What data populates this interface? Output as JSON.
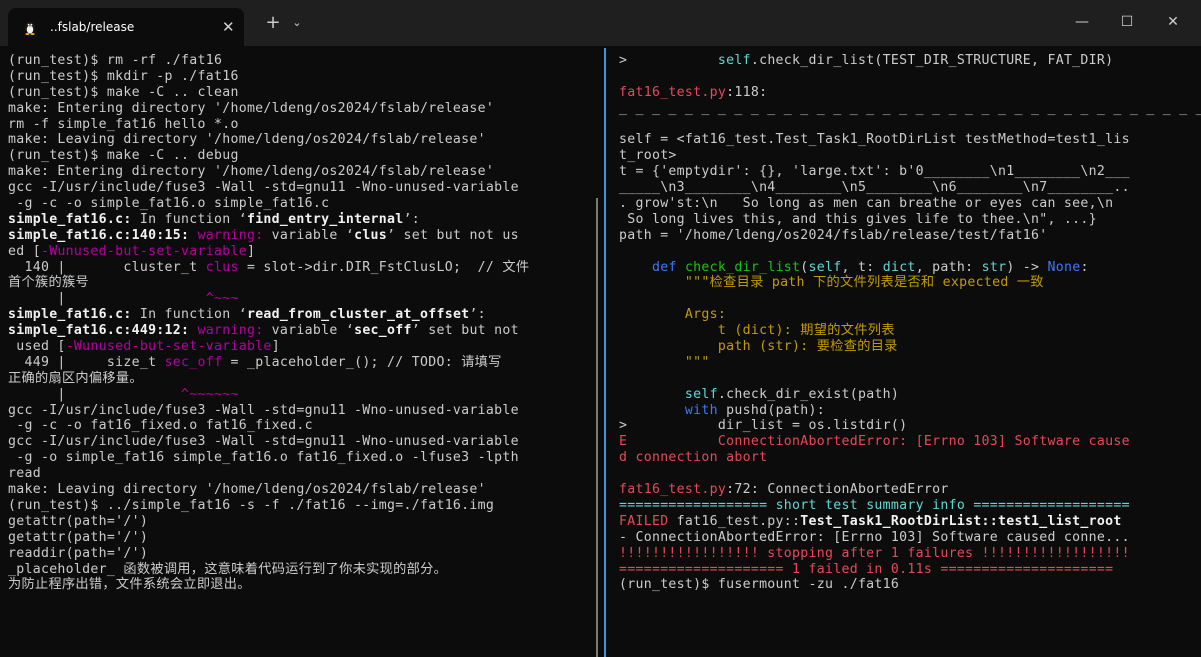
{
  "window": {
    "tab_title": "..fslab/release",
    "tab_icon": "tux-penguin-icon",
    "close_tab_glyph": "✕",
    "new_tab_glyph": "+",
    "dropdown_glyph": "⌄",
    "minimize_glyph": "—",
    "maximize_glyph": "☐",
    "close_glyph": "✕"
  },
  "colors": {
    "terminal_bg": "#0c0c0c",
    "titlebar_bg": "#1f1f1f",
    "pane_divider": "#3a96dd",
    "text": "#cccccc",
    "magenta": "#b4009e",
    "red": "#e74856",
    "yellow": "#c19c00",
    "blue": "#3b78ff",
    "green": "#16c60c",
    "cyan": "#61d6d6"
  },
  "left_pane": {
    "lines": [
      [
        {
          "t": "(run_test)$ rm -rf ./fat16"
        }
      ],
      [
        {
          "t": "(run_test)$ mkdir -p ./fat16"
        }
      ],
      [
        {
          "t": "(run_test)$ make -C .. clean"
        }
      ],
      [
        {
          "t": "make: Entering directory '/home/ldeng/os2024/fslab/release'"
        }
      ],
      [
        {
          "t": "rm -f simple_fat16 hello *.o"
        }
      ],
      [
        {
          "t": "make: Leaving directory '/home/ldeng/os2024/fslab/release'"
        }
      ],
      [
        {
          "t": "(run_test)$ make -C .. debug"
        }
      ],
      [
        {
          "t": "make: Entering directory '/home/ldeng/os2024/fslab/release'"
        }
      ],
      [
        {
          "t": "gcc -I/usr/include/fuse3 -Wall -std=gnu11 -Wno-unused-variable"
        }
      ],
      [
        {
          "t": " -g -c -o simple_fat16.o simple_fat16.c"
        }
      ],
      [
        {
          "t": "simple_fat16.c:",
          "s": "bold"
        },
        {
          "t": " In function ‘"
        },
        {
          "t": "find_entry_internal",
          "s": "bold"
        },
        {
          "t": "’:"
        }
      ],
      [
        {
          "t": "simple_fat16.c:140:15:",
          "s": "bold"
        },
        {
          "t": " warning:",
          "s": "mag"
        },
        {
          "t": " variable ‘"
        },
        {
          "t": "clus",
          "s": "bold"
        },
        {
          "t": "’ set but not us"
        }
      ],
      [
        {
          "t": "ed ["
        },
        {
          "t": "-Wunused-but-set-variable",
          "s": "mag"
        },
        {
          "t": "]"
        }
      ],
      [
        {
          "t": "  140 |       cluster_t "
        },
        {
          "t": "clus",
          "s": "mag"
        },
        {
          "t": " = slot->dir.DIR_FstClusLO;  // 文件"
        }
      ],
      [
        {
          "t": "首个簇的簇号"
        }
      ],
      [
        {
          "t": "      |                 "
        },
        {
          "t": "^~~~",
          "s": "mag"
        }
      ],
      [
        {
          "t": "simple_fat16.c:",
          "s": "bold"
        },
        {
          "t": " In function ‘"
        },
        {
          "t": "read_from_cluster_at_offset",
          "s": "bold"
        },
        {
          "t": "’:"
        }
      ],
      [
        {
          "t": "simple_fat16.c:449:12:",
          "s": "bold"
        },
        {
          "t": " warning:",
          "s": "mag"
        },
        {
          "t": " variable ‘"
        },
        {
          "t": "sec_off",
          "s": "bold"
        },
        {
          "t": "’ set but not"
        }
      ],
      [
        {
          "t": " used ["
        },
        {
          "t": "-Wunused-but-set-variable",
          "s": "mag"
        },
        {
          "t": "]"
        }
      ],
      [
        {
          "t": "  449 |     size_t "
        },
        {
          "t": "sec_off",
          "s": "mag"
        },
        {
          "t": " = _placeholder_(); // TODO: 请填写"
        }
      ],
      [
        {
          "t": "正确的扇区内偏移量。"
        }
      ],
      [
        {
          "t": "      |              "
        },
        {
          "t": "^~~~~~~",
          "s": "mag"
        }
      ],
      [
        {
          "t": "gcc -I/usr/include/fuse3 -Wall -std=gnu11 -Wno-unused-variable"
        }
      ],
      [
        {
          "t": " -g -c -o fat16_fixed.o fat16_fixed.c"
        }
      ],
      [
        {
          "t": "gcc -I/usr/include/fuse3 -Wall -std=gnu11 -Wno-unused-variable"
        }
      ],
      [
        {
          "t": " -g -o simple_fat16 simple_fat16.o fat16_fixed.o -lfuse3 -lpth"
        }
      ],
      [
        {
          "t": "read"
        }
      ],
      [
        {
          "t": "make: Leaving directory '/home/ldeng/os2024/fslab/release'"
        }
      ],
      [
        {
          "t": "(run_test)$ ../simple_fat16 -s -f ./fat16 --img=./fat16.img"
        }
      ],
      [
        {
          "t": "getattr(path='/')"
        }
      ],
      [
        {
          "t": "getattr(path='/')"
        }
      ],
      [
        {
          "t": "readdir(path='/')"
        }
      ],
      [
        {
          "t": "_placeholder_ 函数被调用，这意味着代码运行到了你未实现的部分。"
        }
      ],
      [
        {
          "t": "为防止程序出错，文件系统会立即退出。"
        }
      ]
    ]
  },
  "right_pane": {
    "lines": [
      [
        {
          "t": ">           "
        },
        {
          "t": "self",
          "s": "cyan"
        },
        {
          "t": ".check_dir_list(TEST_DIR_STRUCTURE, FAT_DIR)"
        }
      ],
      [
        {
          "t": ""
        }
      ],
      [
        {
          "t": "fat16_test.py",
          "s": "red"
        },
        {
          "t": ":118:"
        }
      ],
      [
        {
          "t": "_ _ _ _ _ _ _ _ _ _ _ _ _ _ _ _ _ _ _ _ _ _ _ _ _ _ _ _ _ _ _ _ _ _ _ _ _ _ _ _"
        }
      ],
      [
        {
          "t": ""
        }
      ],
      [
        {
          "t": "self = <fat16_test.Test_Task1_RootDirList testMethod=test1_lis"
        }
      ],
      [
        {
          "t": "t_root>"
        }
      ],
      [
        {
          "t": "t = {'emptydir': {}, 'large.txt': b'0________\\n1________\\n2___"
        }
      ],
      [
        {
          "t": "_____\\n3________\\n4________\\n5________\\n6________\\n7________.."
        }
      ],
      [
        {
          "t": ". grow'st:\\n   So long as men can breathe or eyes can see,\\n"
        }
      ],
      [
        {
          "t": " So long lives this, and this gives life to thee.\\n\", ...}"
        }
      ],
      [
        {
          "t": "path = '/home/ldeng/os2024/fslab/release/test/fat16'"
        }
      ],
      [
        {
          "t": ""
        }
      ],
      [
        {
          "t": "    "
        },
        {
          "t": "def",
          "s": "blue"
        },
        {
          "t": " "
        },
        {
          "t": "check_dir_list",
          "s": "green"
        },
        {
          "t": "("
        },
        {
          "t": "self",
          "s": "cyan"
        },
        {
          "t": ", t: "
        },
        {
          "t": "dict",
          "s": "cyan"
        },
        {
          "t": ", path: "
        },
        {
          "t": "str",
          "s": "cyan"
        },
        {
          "t": ") -> "
        },
        {
          "t": "None",
          "s": "blue"
        },
        {
          "t": ":"
        }
      ],
      [
        {
          "t": "        "
        },
        {
          "t": "\"\"\"检查目录 path 下的文件列表是否和 expected 一致",
          "s": "yellow"
        }
      ],
      [
        {
          "t": ""
        }
      ],
      [
        {
          "t": "        "
        },
        {
          "t": "Args:",
          "s": "yellow"
        }
      ],
      [
        {
          "t": "            "
        },
        {
          "t": "t (dict): 期望的文件列表",
          "s": "yellow"
        }
      ],
      [
        {
          "t": "            "
        },
        {
          "t": "path (str): 要检查的目录",
          "s": "yellow"
        }
      ],
      [
        {
          "t": "        "
        },
        {
          "t": "\"\"\"",
          "s": "yellow"
        }
      ],
      [
        {
          "t": ""
        }
      ],
      [
        {
          "t": "        "
        },
        {
          "t": "self",
          "s": "cyan"
        },
        {
          "t": ".check_dir_exist(path)"
        }
      ],
      [
        {
          "t": "        "
        },
        {
          "t": "with",
          "s": "blue"
        },
        {
          "t": " pushd(path):"
        }
      ],
      [
        {
          "t": ">           dir_list = os.listdir()"
        }
      ],
      [
        {
          "t": "E           ConnectionAbortedError: [Errno 103] Software cause",
          "s": "red"
        }
      ],
      [
        {
          "t": "d connection abort",
          "s": "red"
        }
      ],
      [
        {
          "t": ""
        }
      ],
      [
        {
          "t": "fat16_test.py",
          "s": "red"
        },
        {
          "t": ":72: ConnectionAbortedError"
        }
      ],
      [
        {
          "t": "================== ",
          "s": "cyan"
        },
        {
          "t": "short test summary info",
          "s": "cyan"
        },
        {
          "t": " ===================",
          "s": "cyan"
        }
      ],
      [
        {
          "t": "FAILED",
          "s": "red"
        },
        {
          "t": " fat16_test.py::"
        },
        {
          "t": "Test_Task1_RootDirList::test1_list_root",
          "s": "bold"
        }
      ],
      [
        {
          "t": "- ConnectionAbortedError: [Errno 103] Software caused conne..."
        }
      ],
      [
        {
          "t": "!!!!!!!!!!!!!!!!! stopping after 1 failures !!!!!!!!!!!!!!!!!!",
          "s": "red"
        }
      ],
      [
        {
          "t": "==================== 1 failed in 0.11s =====================",
          "s": "red"
        }
      ],
      [
        {
          "t": "(run_test)$ fusermount -zu ./fat16"
        }
      ]
    ]
  }
}
